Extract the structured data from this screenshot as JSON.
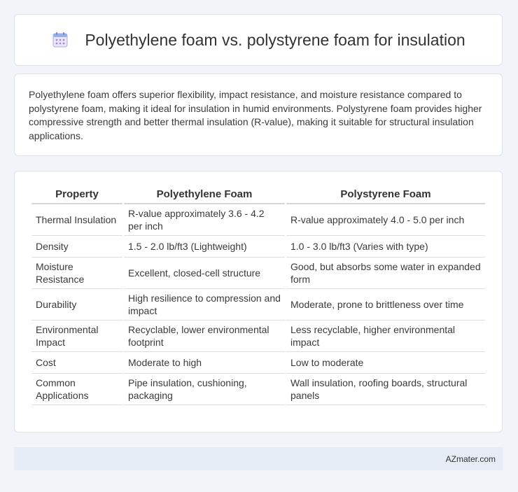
{
  "header": {
    "title": "Polyethylene foam vs. polystyrene foam for insulation",
    "icon": "calendar-grid-icon"
  },
  "summary": {
    "text": "Polyethylene foam offers superior flexibility, impact resistance, and moisture resistance compared to polystyrene foam, making it ideal for insulation in humid environments. Polystyrene foam provides higher compressive strength and better thermal insulation (R-value), making it suitable for structural insulation applications."
  },
  "table": {
    "headers": [
      "Property",
      "Polyethylene Foam",
      "Polystyrene Foam"
    ],
    "rows": [
      {
        "property": "Thermal Insulation",
        "pe": "R-value approximately 3.6 - 4.2 per inch",
        "ps": "R-value approximately 4.0 - 5.0 per inch"
      },
      {
        "property": "Density",
        "pe": "1.5 - 2.0 lb/ft3 (Lightweight)",
        "ps": "1.0 - 3.0 lb/ft3 (Varies with type)"
      },
      {
        "property": "Moisture Resistance",
        "pe": "Excellent, closed-cell structure",
        "ps": "Good, but absorbs some water in expanded form"
      },
      {
        "property": "Durability",
        "pe": "High resilience to compression and impact",
        "ps": "Moderate, prone to brittleness over time"
      },
      {
        "property": "Environmental Impact",
        "pe": "Recyclable, lower environmental footprint",
        "ps": "Less recyclable, higher environmental impact"
      },
      {
        "property": "Cost",
        "pe": "Moderate to high",
        "ps": "Low to moderate"
      },
      {
        "property": "Common Applications",
        "pe": "Pipe insulation, cushioning, packaging",
        "ps": "Wall insulation, roofing boards, structural panels"
      }
    ]
  },
  "footer": {
    "brand": "AZmater.com"
  }
}
